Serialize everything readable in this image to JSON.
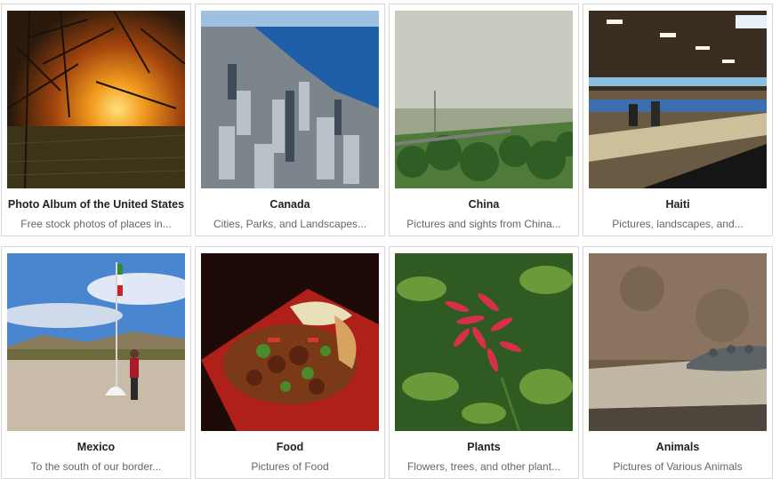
{
  "albums": [
    {
      "title": "Photo Album of the United States",
      "desc": "Free stock photos of places in...",
      "image": "sunset-forest-photo"
    },
    {
      "title": "Canada",
      "desc": "Cities, Parks, and Landscapes...",
      "image": "toronto-aerial-photo"
    },
    {
      "title": "China",
      "desc": "Pictures and sights from China...",
      "image": "hazy-landscape-photo"
    },
    {
      "title": "Haiti",
      "desc": "Pictures, landscapes, and...",
      "image": "factory-interior-photo"
    },
    {
      "title": "Mexico",
      "desc": "To the south of our border...",
      "image": "desert-flag-photo"
    },
    {
      "title": "Food",
      "desc": "Pictures of Food",
      "image": "stir-fry-plate-photo"
    },
    {
      "title": "Plants",
      "desc": "Flowers, trees, and other plant...",
      "image": "red-flower-photo"
    },
    {
      "title": "Animals",
      "desc": "Pictures of Various Animals",
      "image": "crocodile-rock-photo"
    }
  ]
}
